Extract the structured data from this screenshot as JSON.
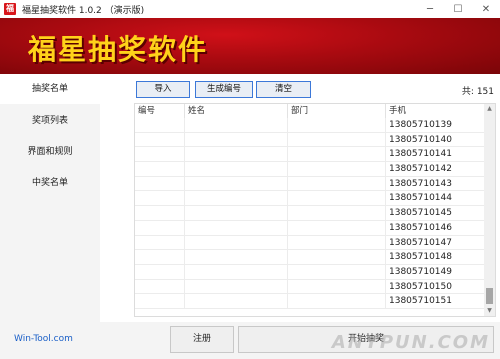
{
  "window": {
    "title": "福星抽奖软件 1.0.2 （演示版)",
    "icon_text": "福",
    "controls": {
      "minimize": "─",
      "maximize": "☐",
      "close": "✕"
    }
  },
  "banner": {
    "title": "福星抽奖软件"
  },
  "sidebar": {
    "items": [
      {
        "label": "抽奖名单",
        "active": true
      },
      {
        "label": "奖项列表",
        "active": false
      },
      {
        "label": "界面和规则",
        "active": false
      },
      {
        "label": "中奖名单",
        "active": false
      }
    ]
  },
  "toolbar": {
    "import_label": "导入",
    "generate_label": "生成编号",
    "clear_label": "清空",
    "count_text": "共: 151"
  },
  "table": {
    "columns": [
      "编号",
      "姓名",
      "部门",
      "手机"
    ],
    "rows": [
      [
        "",
        "",
        "",
        "13805710139"
      ],
      [
        "",
        "",
        "",
        "13805710140"
      ],
      [
        "",
        "",
        "",
        "13805710141"
      ],
      [
        "",
        "",
        "",
        "13805710142"
      ],
      [
        "",
        "",
        "",
        "13805710143"
      ],
      [
        "",
        "",
        "",
        "13805710144"
      ],
      [
        "",
        "",
        "",
        "13805710145"
      ],
      [
        "",
        "",
        "",
        "13805710146"
      ],
      [
        "",
        "",
        "",
        "13805710147"
      ],
      [
        "",
        "",
        "",
        "13805710148"
      ],
      [
        "",
        "",
        "",
        "13805710149"
      ],
      [
        "",
        "",
        "",
        "13805710150"
      ],
      [
        "",
        "",
        "",
        "13805710151"
      ]
    ]
  },
  "footer": {
    "link_text": "Win-Tool.com",
    "register_label": "注册",
    "start_label": "开始抽奖",
    "watermark": "ANYPUN.COM"
  },
  "colors": {
    "banner_red": "#a80a10",
    "banner_text": "#ffd21a",
    "accent_blue": "#3c78d8",
    "link_blue": "#1a5fc7"
  }
}
